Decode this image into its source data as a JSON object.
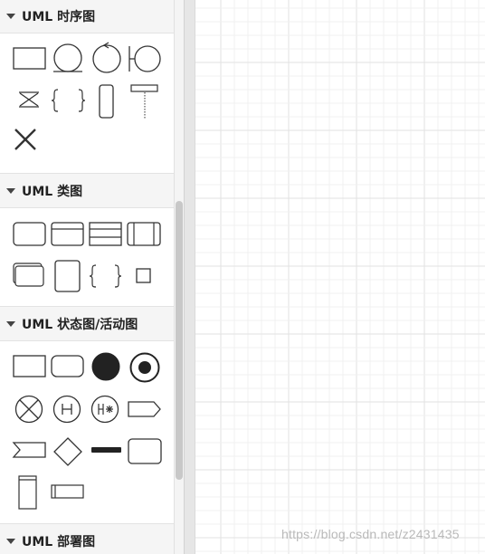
{
  "sidebar": {
    "sections": [
      {
        "title": "UML 时序图"
      },
      {
        "title": "UML 类图"
      },
      {
        "title": "UML 状态图/活动图"
      },
      {
        "title": "UML 部署图"
      }
    ]
  },
  "watermark": {
    "text": "https://blog.csdn.net/z2431435"
  },
  "colors": {
    "shape_stroke": "#333333",
    "grid": "#ececec",
    "header_bg": "#f5f5f5"
  }
}
